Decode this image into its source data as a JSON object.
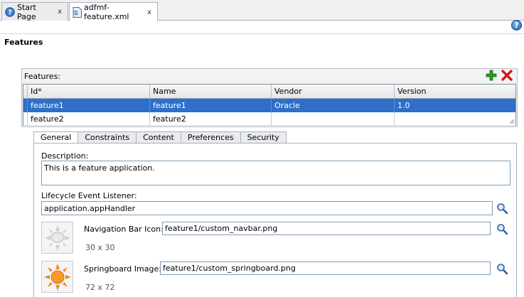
{
  "tabs": [
    {
      "label": "Start Page",
      "icon": "help-page-icon",
      "active": false
    },
    {
      "label": "adfmf-feature.xml",
      "icon": "xml-file-icon",
      "active": true
    }
  ],
  "tab_close_glyph": "x",
  "help_glyph": "?",
  "page_title": "Features",
  "features_panel": {
    "label": "Features:",
    "columns": [
      "Id*",
      "Name",
      "Vendor",
      "Version"
    ],
    "rows": [
      {
        "id": "feature1",
        "name": "feature1",
        "vendor": "Oracle",
        "version": "1.0",
        "selected": true
      },
      {
        "id": "feature2",
        "name": "feature2",
        "vendor": "",
        "version": "",
        "selected": false
      }
    ]
  },
  "subtabs": [
    "General",
    "Constraints",
    "Content",
    "Preferences",
    "Security"
  ],
  "active_subtab": "General",
  "general": {
    "description_label": "Description:",
    "description_value": "This is a feature application.",
    "lifecycle_label": "Lifecycle Event Listener:",
    "lifecycle_value": "application.appHandler",
    "navbar_label": "Navigation Bar Icon:",
    "navbar_value": "feature1/custom_navbar.png",
    "navbar_size": "30 x 30",
    "springboard_label": "Springboard Image:",
    "springboard_value": "feature1/custom_springboard.png",
    "springboard_size": "72 x 72"
  },
  "colors": {
    "selection": "#2d6fc9",
    "add_green": "#2a9b1e",
    "delete_red": "#d11a1a",
    "sun_orange": "#f08a1c"
  }
}
